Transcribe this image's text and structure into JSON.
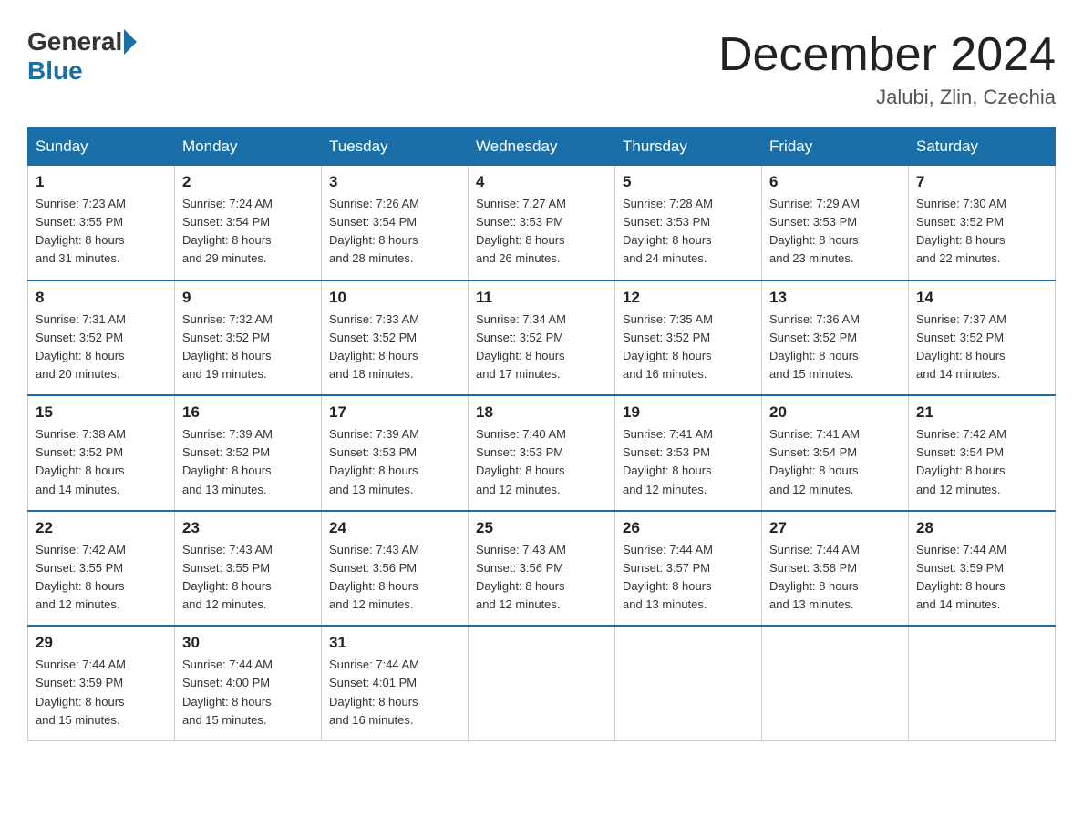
{
  "header": {
    "logo_general": "General",
    "logo_blue": "Blue",
    "month_title": "December 2024",
    "location": "Jalubi, Zlin, Czechia"
  },
  "days_of_week": [
    "Sunday",
    "Monday",
    "Tuesday",
    "Wednesday",
    "Thursday",
    "Friday",
    "Saturday"
  ],
  "weeks": [
    [
      {
        "day": "1",
        "sunrise": "7:23 AM",
        "sunset": "3:55 PM",
        "daylight": "8 hours and 31 minutes."
      },
      {
        "day": "2",
        "sunrise": "7:24 AM",
        "sunset": "3:54 PM",
        "daylight": "8 hours and 29 minutes."
      },
      {
        "day": "3",
        "sunrise": "7:26 AM",
        "sunset": "3:54 PM",
        "daylight": "8 hours and 28 minutes."
      },
      {
        "day": "4",
        "sunrise": "7:27 AM",
        "sunset": "3:53 PM",
        "daylight": "8 hours and 26 minutes."
      },
      {
        "day": "5",
        "sunrise": "7:28 AM",
        "sunset": "3:53 PM",
        "daylight": "8 hours and 24 minutes."
      },
      {
        "day": "6",
        "sunrise": "7:29 AM",
        "sunset": "3:53 PM",
        "daylight": "8 hours and 23 minutes."
      },
      {
        "day": "7",
        "sunrise": "7:30 AM",
        "sunset": "3:52 PM",
        "daylight": "8 hours and 22 minutes."
      }
    ],
    [
      {
        "day": "8",
        "sunrise": "7:31 AM",
        "sunset": "3:52 PM",
        "daylight": "8 hours and 20 minutes."
      },
      {
        "day": "9",
        "sunrise": "7:32 AM",
        "sunset": "3:52 PM",
        "daylight": "8 hours and 19 minutes."
      },
      {
        "day": "10",
        "sunrise": "7:33 AM",
        "sunset": "3:52 PM",
        "daylight": "8 hours and 18 minutes."
      },
      {
        "day": "11",
        "sunrise": "7:34 AM",
        "sunset": "3:52 PM",
        "daylight": "8 hours and 17 minutes."
      },
      {
        "day": "12",
        "sunrise": "7:35 AM",
        "sunset": "3:52 PM",
        "daylight": "8 hours and 16 minutes."
      },
      {
        "day": "13",
        "sunrise": "7:36 AM",
        "sunset": "3:52 PM",
        "daylight": "8 hours and 15 minutes."
      },
      {
        "day": "14",
        "sunrise": "7:37 AM",
        "sunset": "3:52 PM",
        "daylight": "8 hours and 14 minutes."
      }
    ],
    [
      {
        "day": "15",
        "sunrise": "7:38 AM",
        "sunset": "3:52 PM",
        "daylight": "8 hours and 14 minutes."
      },
      {
        "day": "16",
        "sunrise": "7:39 AM",
        "sunset": "3:52 PM",
        "daylight": "8 hours and 13 minutes."
      },
      {
        "day": "17",
        "sunrise": "7:39 AM",
        "sunset": "3:53 PM",
        "daylight": "8 hours and 13 minutes."
      },
      {
        "day": "18",
        "sunrise": "7:40 AM",
        "sunset": "3:53 PM",
        "daylight": "8 hours and 12 minutes."
      },
      {
        "day": "19",
        "sunrise": "7:41 AM",
        "sunset": "3:53 PM",
        "daylight": "8 hours and 12 minutes."
      },
      {
        "day": "20",
        "sunrise": "7:41 AM",
        "sunset": "3:54 PM",
        "daylight": "8 hours and 12 minutes."
      },
      {
        "day": "21",
        "sunrise": "7:42 AM",
        "sunset": "3:54 PM",
        "daylight": "8 hours and 12 minutes."
      }
    ],
    [
      {
        "day": "22",
        "sunrise": "7:42 AM",
        "sunset": "3:55 PM",
        "daylight": "8 hours and 12 minutes."
      },
      {
        "day": "23",
        "sunrise": "7:43 AM",
        "sunset": "3:55 PM",
        "daylight": "8 hours and 12 minutes."
      },
      {
        "day": "24",
        "sunrise": "7:43 AM",
        "sunset": "3:56 PM",
        "daylight": "8 hours and 12 minutes."
      },
      {
        "day": "25",
        "sunrise": "7:43 AM",
        "sunset": "3:56 PM",
        "daylight": "8 hours and 12 minutes."
      },
      {
        "day": "26",
        "sunrise": "7:44 AM",
        "sunset": "3:57 PM",
        "daylight": "8 hours and 13 minutes."
      },
      {
        "day": "27",
        "sunrise": "7:44 AM",
        "sunset": "3:58 PM",
        "daylight": "8 hours and 13 minutes."
      },
      {
        "day": "28",
        "sunrise": "7:44 AM",
        "sunset": "3:59 PM",
        "daylight": "8 hours and 14 minutes."
      }
    ],
    [
      {
        "day": "29",
        "sunrise": "7:44 AM",
        "sunset": "3:59 PM",
        "daylight": "8 hours and 15 minutes."
      },
      {
        "day": "30",
        "sunrise": "7:44 AM",
        "sunset": "4:00 PM",
        "daylight": "8 hours and 15 minutes."
      },
      {
        "day": "31",
        "sunrise": "7:44 AM",
        "sunset": "4:01 PM",
        "daylight": "8 hours and 16 minutes."
      },
      null,
      null,
      null,
      null
    ]
  ],
  "labels": {
    "sunrise": "Sunrise:",
    "sunset": "Sunset:",
    "daylight": "Daylight:"
  }
}
